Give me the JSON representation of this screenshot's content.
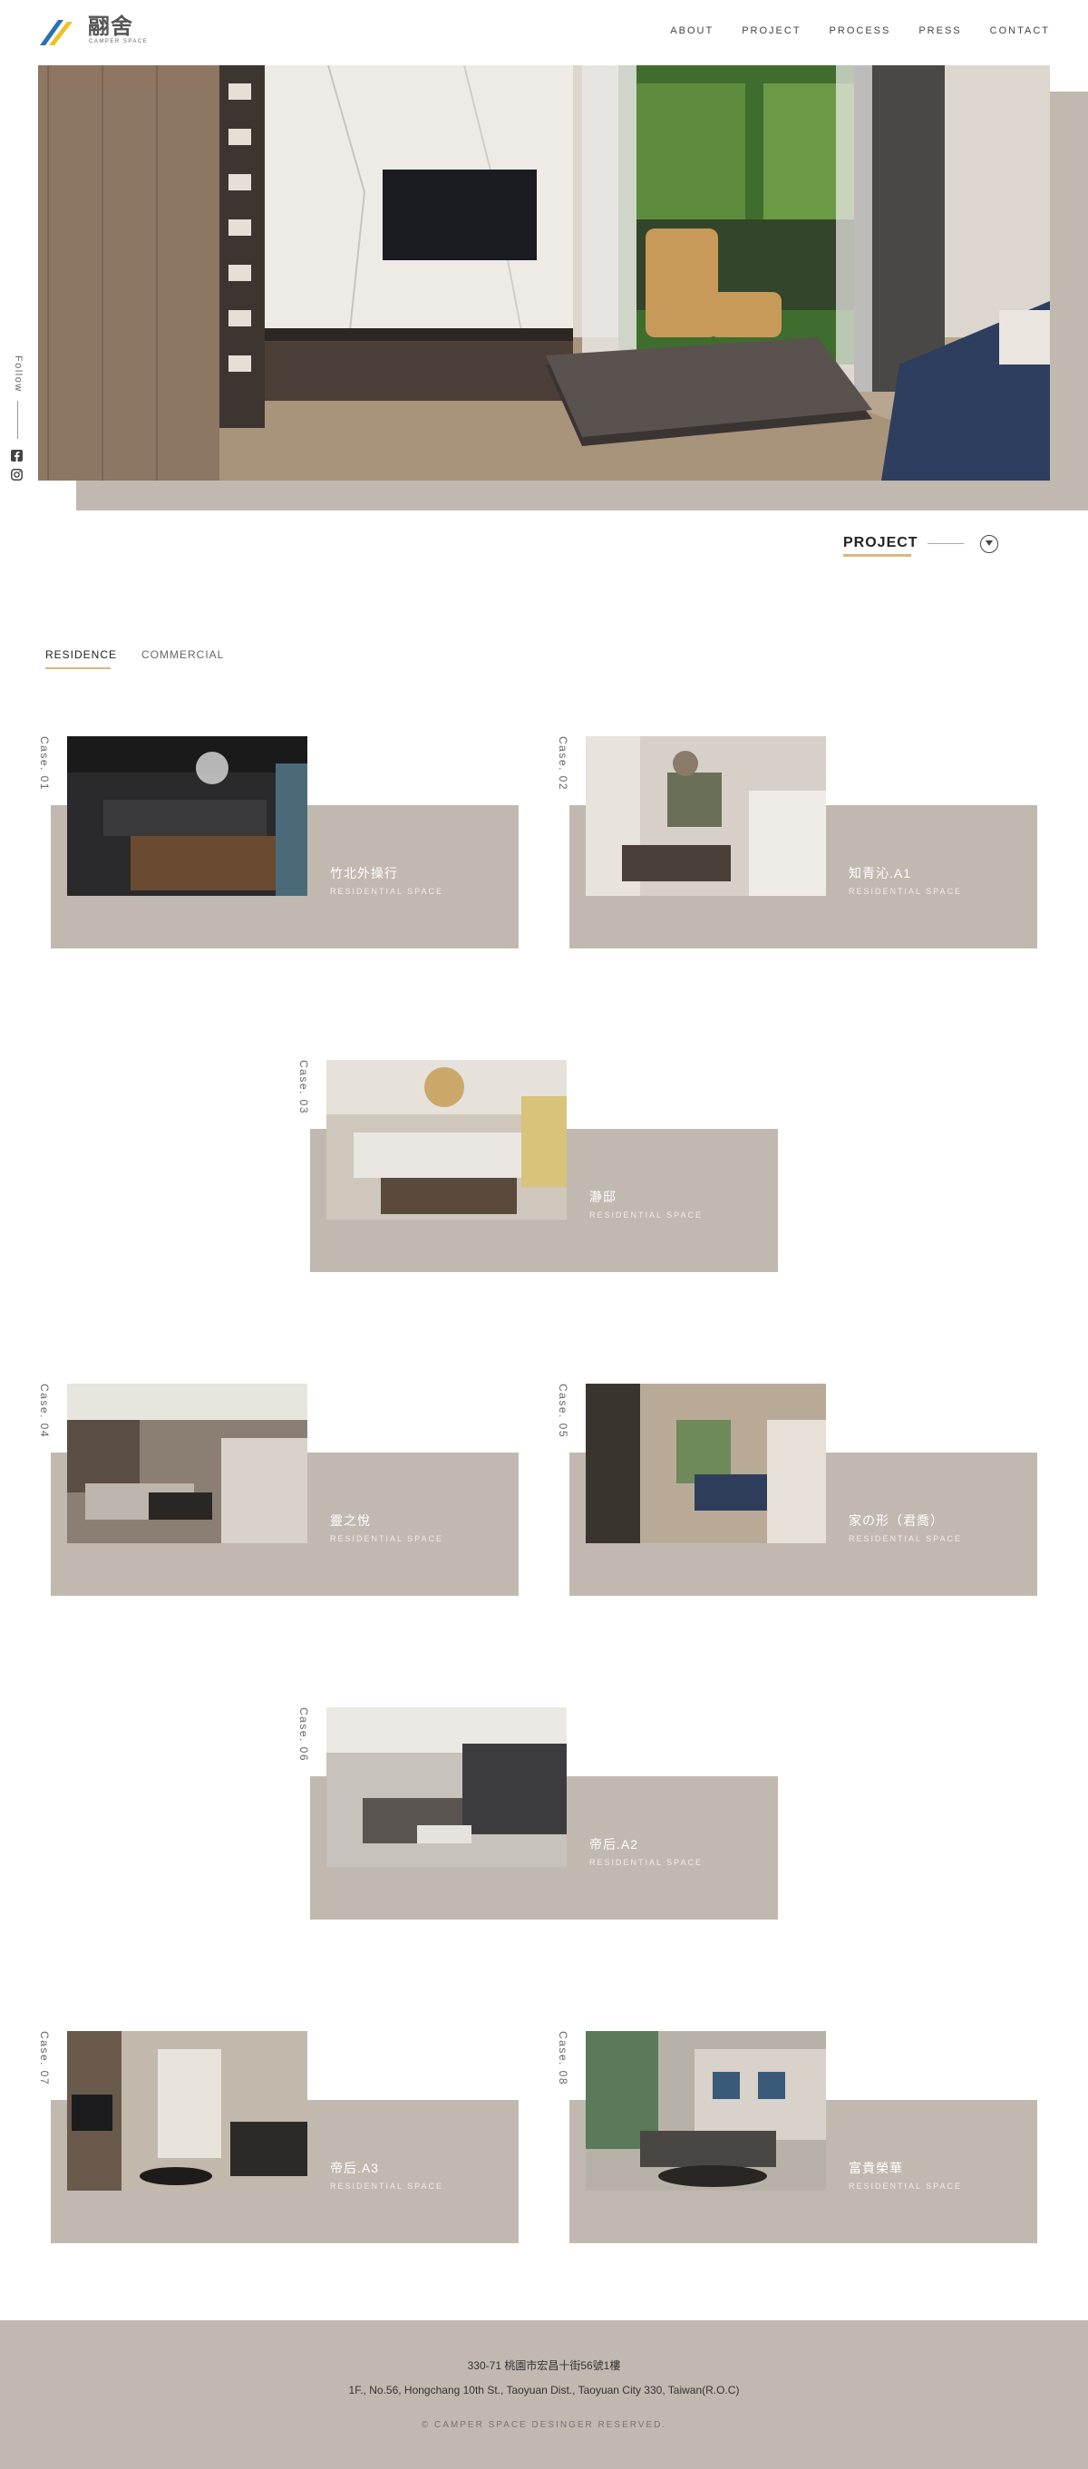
{
  "header": {
    "logo_cn": "翮舍",
    "logo_en": "CAMPER SPACE",
    "nav": [
      "ABOUT",
      "PROJECT",
      "PROCESS",
      "PRESS",
      "CONTACT"
    ]
  },
  "sidebar": {
    "follow_label": "Follow",
    "social": [
      "facebook-icon",
      "instagram-icon"
    ]
  },
  "section": {
    "title": "PROJECT"
  },
  "tabs": [
    "RESIDENCE",
    "COMMERCIAL"
  ],
  "cases": [
    {
      "num": "Case. 01",
      "name": "竹北外操行",
      "type": "RESIDENTIAL SPACE"
    },
    {
      "num": "Case. 02",
      "name": "知青沁.A1",
      "type": "RESIDENTIAL SPACE"
    },
    {
      "num": "Case. 03",
      "name": "瀞邸",
      "type": "RESIDENTIAL SPACE"
    },
    {
      "num": "Case. 04",
      "name": "靈之悅",
      "type": "RESIDENTIAL SPACE"
    },
    {
      "num": "Case. 05",
      "name": "家の形（君喬）",
      "type": "RESIDENTIAL SPACE"
    },
    {
      "num": "Case. 06",
      "name": "帝后.A2",
      "type": "RESIDENTIAL SPACE"
    },
    {
      "num": "Case. 07",
      "name": "帝后.A3",
      "type": "RESIDENTIAL SPACE"
    },
    {
      "num": "Case. 08",
      "name": "富貴榮華",
      "type": "RESIDENTIAL SPACE"
    }
  ],
  "footer": {
    "address_cn": "330-71 桃園市宏昌十街56號1樓",
    "address_en": "1F., No.56, Hongchang 10th St., Taoyuan Dist., Taoyuan City 330, Taiwan(R.O.C)",
    "copyright": "© CAMPER SPACE DESINGER RESERVED."
  },
  "colors": {
    "taupe": "#c1b8b0",
    "gold_accent": "#d8b97a"
  }
}
